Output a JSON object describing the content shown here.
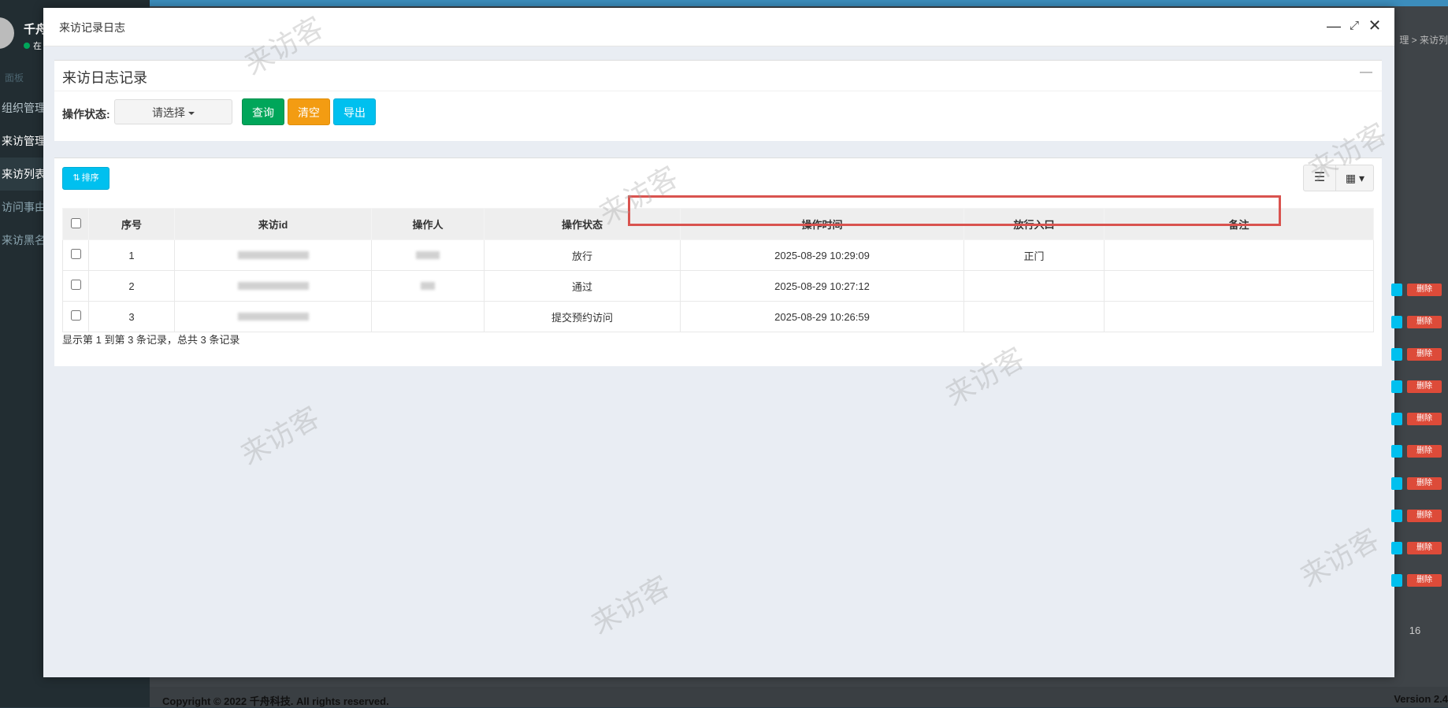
{
  "background": {
    "profile_name": "千舟",
    "online_label": "在",
    "menu_header": "面板",
    "menu_items": [
      "组织管理",
      "来访管理",
      "来访列表",
      "访问事由",
      "来访黑名"
    ],
    "breadcrumb": "理 > 来访列",
    "delete_label": "删除",
    "page_number": "16",
    "footer_copy": "Copyright © 2022 千舟科技. All rights reserved.",
    "footer_version": "Version 2.4"
  },
  "modal": {
    "title": "来访记录日志",
    "controls": {
      "minimize": "—",
      "maximize": "⤢",
      "close": "✕"
    }
  },
  "search": {
    "box_title": "来访日志记录",
    "collapse_symbol": "—",
    "status_label": "操作状态:",
    "status_select": "请选择",
    "query_button": "查询",
    "clear_button": "清空",
    "export_button": "导出"
  },
  "table": {
    "sort_button": "排序",
    "columns": [
      "序号",
      "来访id",
      "操作人",
      "操作状态",
      "操作时间",
      "放行入口",
      "备注"
    ],
    "rows": [
      {
        "index": "1",
        "status": "放行",
        "time": "2025-08-29 10:29:09",
        "entrance": "正门",
        "note": ""
      },
      {
        "index": "2",
        "status": "通过",
        "time": "2025-08-29 10:27:12",
        "entrance": "",
        "note": ""
      },
      {
        "index": "3",
        "status": "提交预约访问",
        "time": "2025-08-29 10:26:59",
        "entrance": "",
        "note": ""
      }
    ],
    "pager_text": "显示第 1 到第 3 条记录，总共 3 条记录"
  },
  "watermark": "来访客",
  "colors": {
    "success": "#00a65a",
    "warning": "#f39c12",
    "info": "#00c0ef",
    "danger": "#dd4b39",
    "highlight": "#d9534f"
  }
}
